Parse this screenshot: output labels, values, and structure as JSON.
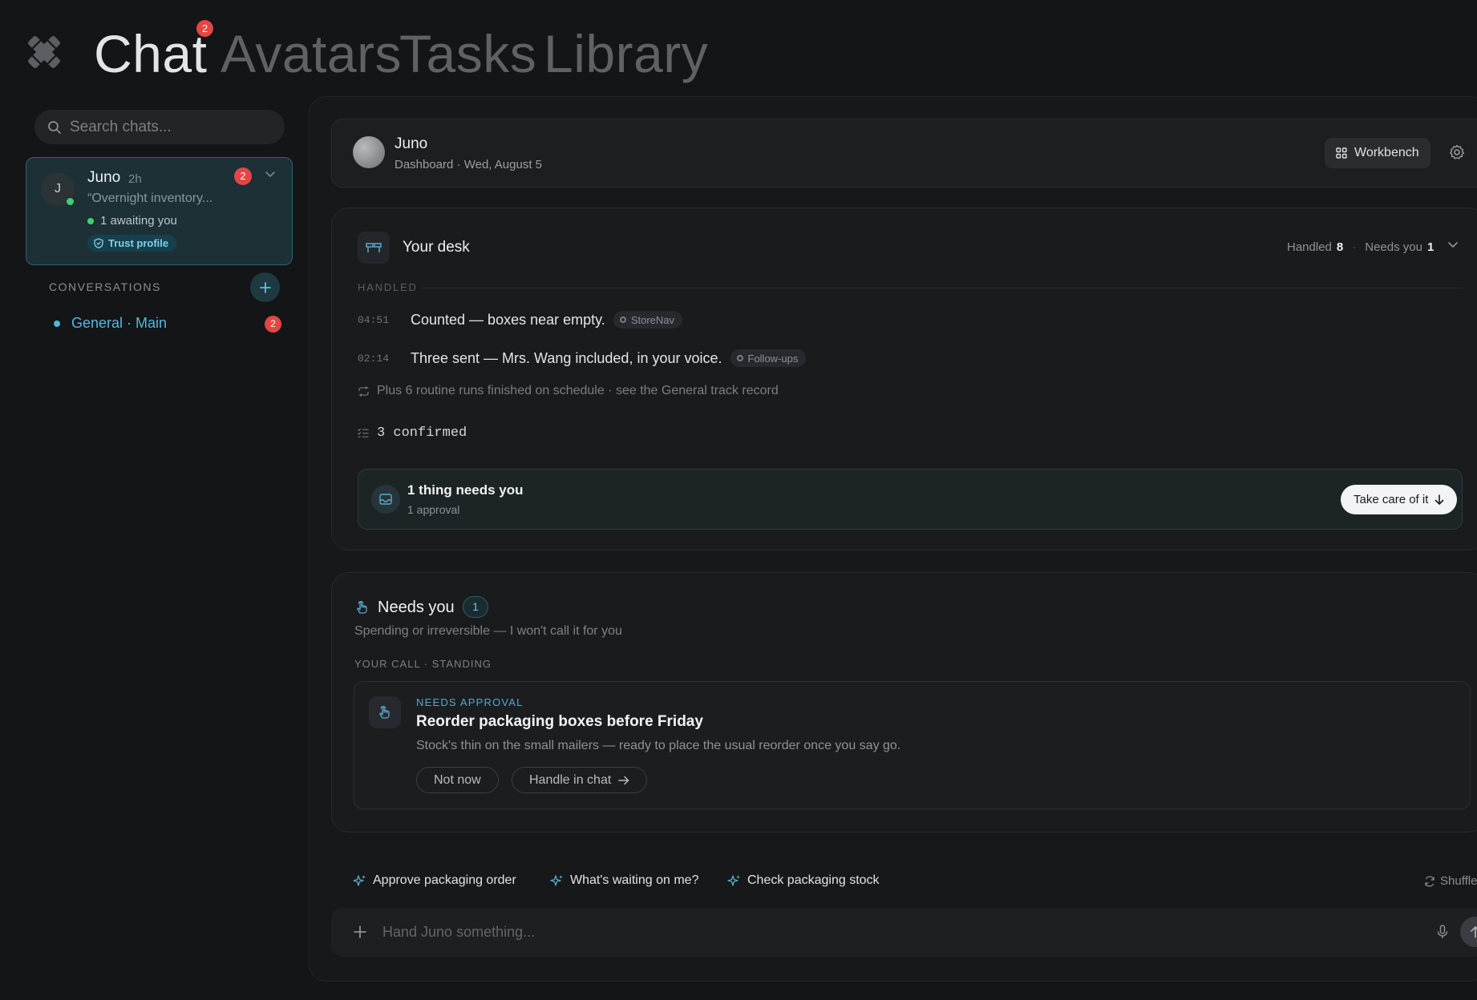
{
  "nav": {
    "tabs": [
      {
        "label": "Chat",
        "active": true,
        "badge": "2"
      },
      {
        "label": "Avatars",
        "active": false
      },
      {
        "label": "Tasks",
        "active": false
      },
      {
        "label": "Library",
        "active": false
      }
    ]
  },
  "sidebar": {
    "search_placeholder": "Search chats...",
    "avatar_card": {
      "initial": "J",
      "name": "Juno",
      "time": "2h",
      "badge": "2",
      "preview": "“Overnight inventory...",
      "awaiting": "1 awaiting you",
      "trust_label": "Trust profile"
    },
    "conversations_label": "CONVERSATIONS",
    "conversations": [
      {
        "label": "General · Main",
        "badge": "2"
      }
    ]
  },
  "header": {
    "name": "Juno",
    "subtitle": "Dashboard · Wed, August 5",
    "workbench_label": "Workbench"
  },
  "desk": {
    "title": "Your desk",
    "handled_label": "Handled",
    "handled_count": "8",
    "needs_label": "Needs you",
    "needs_count": "1",
    "section_label": "HANDLED",
    "log": [
      {
        "time": "04:51",
        "text": "Counted — boxes near empty.",
        "chip": "StoreNav"
      },
      {
        "time": "02:14",
        "text": "Three sent — Mrs. Wang included, in your voice.",
        "chip": "Follow-ups"
      }
    ],
    "routine_text": "Plus 6 routine runs finished on schedule · see the General track record",
    "confirmed_text": "3 confirmed",
    "strip": {
      "title": "1 thing needs you",
      "subtitle": "1 approval",
      "button": "Take care of it"
    }
  },
  "needs_you": {
    "title": "Needs you",
    "count": "1",
    "subtitle": "Spending or irreversible — I won't call it for you",
    "section_label": "YOUR CALL · STANDING",
    "approval": {
      "tag": "NEEDS APPROVAL",
      "title": "Reorder packaging boxes before Friday",
      "description": "Stock's thin on the small mailers — ready to place the usual reorder once you say go.",
      "not_now": "Not now",
      "handle": "Handle in chat"
    }
  },
  "suggestions": [
    "Approve packaging order",
    "What's waiting on me?",
    "Check packaging stock"
  ],
  "shuffle_label": "Shuffle",
  "composer": {
    "placeholder": "Hand Juno something..."
  },
  "colors": {
    "background": "#141516",
    "accent": "#4cb8df",
    "badge": "#e54545",
    "online": "#3fcf6f"
  }
}
